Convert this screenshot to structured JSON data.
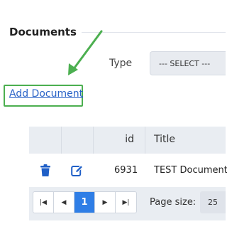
{
  "section": {
    "title": "Documents"
  },
  "filter": {
    "type_label": "Type",
    "type_value": "--- SELECT ---"
  },
  "actions": {
    "add_document": "Add Document"
  },
  "table": {
    "columns": [
      "",
      "",
      "id",
      "Title"
    ],
    "rows": [
      {
        "id": "6931",
        "title": "TEST Document"
      }
    ]
  },
  "pager": {
    "first": "first-page",
    "prev": "previous-page",
    "current_page": "1",
    "next": "next-page",
    "last": "last-page",
    "page_size_label": "Page size:",
    "page_size_value": "25"
  },
  "colors": {
    "accent": "#2f7ee6",
    "link": "#2a63c7",
    "highlight_box": "#4caf50",
    "arrow": "#4caf50",
    "icon": "#1f5fc7"
  }
}
